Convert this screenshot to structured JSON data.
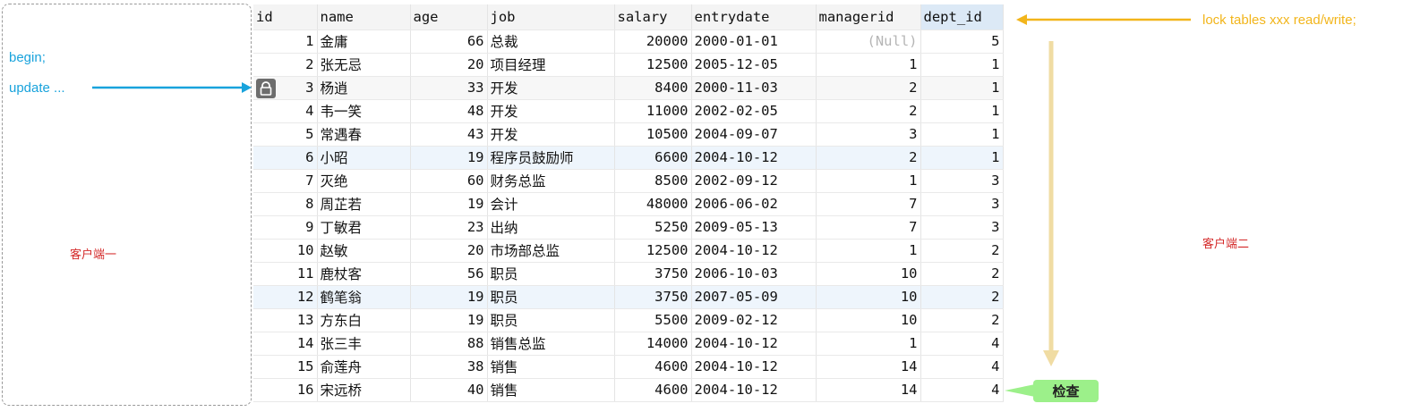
{
  "client1": {
    "label": "客户端一",
    "line1": "begin;",
    "line2": "update ..."
  },
  "client2": {
    "label": "客户端二",
    "command": "lock tables xxx read/write;",
    "check_label": "检查"
  },
  "colors": {
    "client1_text": "#19a3dc",
    "client2_text": "#f2b51b",
    "label_red": "#d42a2a",
    "check_green": "#9cf08a",
    "arrow_tan": "#f0dca3"
  },
  "icons": {
    "row_lock": "lock-icon"
  },
  "table": {
    "columns": [
      "id",
      "name",
      "age",
      "job",
      "salary",
      "entrydate",
      "managerid",
      "dept_id"
    ],
    "selected_column": "dept_id",
    "locked_row_id": "3",
    "rows": [
      [
        "1",
        "金庸",
        "66",
        "总裁",
        "20000",
        "2000-01-01",
        "(Null)",
        "5"
      ],
      [
        "2",
        "张无忌",
        "20",
        "项目经理",
        "12500",
        "2005-12-05",
        "1",
        "1"
      ],
      [
        "3",
        "杨逍",
        "33",
        "开发",
        "8400",
        "2000-11-03",
        "2",
        "1"
      ],
      [
        "4",
        "韦一笑",
        "48",
        "开发",
        "11000",
        "2002-02-05",
        "2",
        "1"
      ],
      [
        "5",
        "常遇春",
        "43",
        "开发",
        "10500",
        "2004-09-07",
        "3",
        "1"
      ],
      [
        "6",
        "小昭",
        "19",
        "程序员鼓励师",
        "6600",
        "2004-10-12",
        "2",
        "1"
      ],
      [
        "7",
        "灭绝",
        "60",
        "财务总监",
        "8500",
        "2002-09-12",
        "1",
        "3"
      ],
      [
        "8",
        "周芷若",
        "19",
        "会计",
        "48000",
        "2006-06-02",
        "7",
        "3"
      ],
      [
        "9",
        "丁敏君",
        "23",
        "出纳",
        "5250",
        "2009-05-13",
        "7",
        "3"
      ],
      [
        "10",
        "赵敏",
        "20",
        "市场部总监",
        "12500",
        "2004-10-12",
        "1",
        "2"
      ],
      [
        "11",
        "鹿杖客",
        "56",
        "职员",
        "3750",
        "2006-10-03",
        "10",
        "2"
      ],
      [
        "12",
        "鹤笔翁",
        "19",
        "职员",
        "3750",
        "2007-05-09",
        "10",
        "2"
      ],
      [
        "13",
        "方东白",
        "19",
        "职员",
        "5500",
        "2009-02-12",
        "10",
        "2"
      ],
      [
        "14",
        "张三丰",
        "88",
        "销售总监",
        "14000",
        "2004-10-12",
        "1",
        "4"
      ],
      [
        "15",
        "俞莲舟",
        "38",
        "销售",
        "4600",
        "2004-10-12",
        "14",
        "4"
      ],
      [
        "16",
        "宋远桥",
        "40",
        "销售",
        "4600",
        "2004-10-12",
        "14",
        "4"
      ]
    ]
  }
}
